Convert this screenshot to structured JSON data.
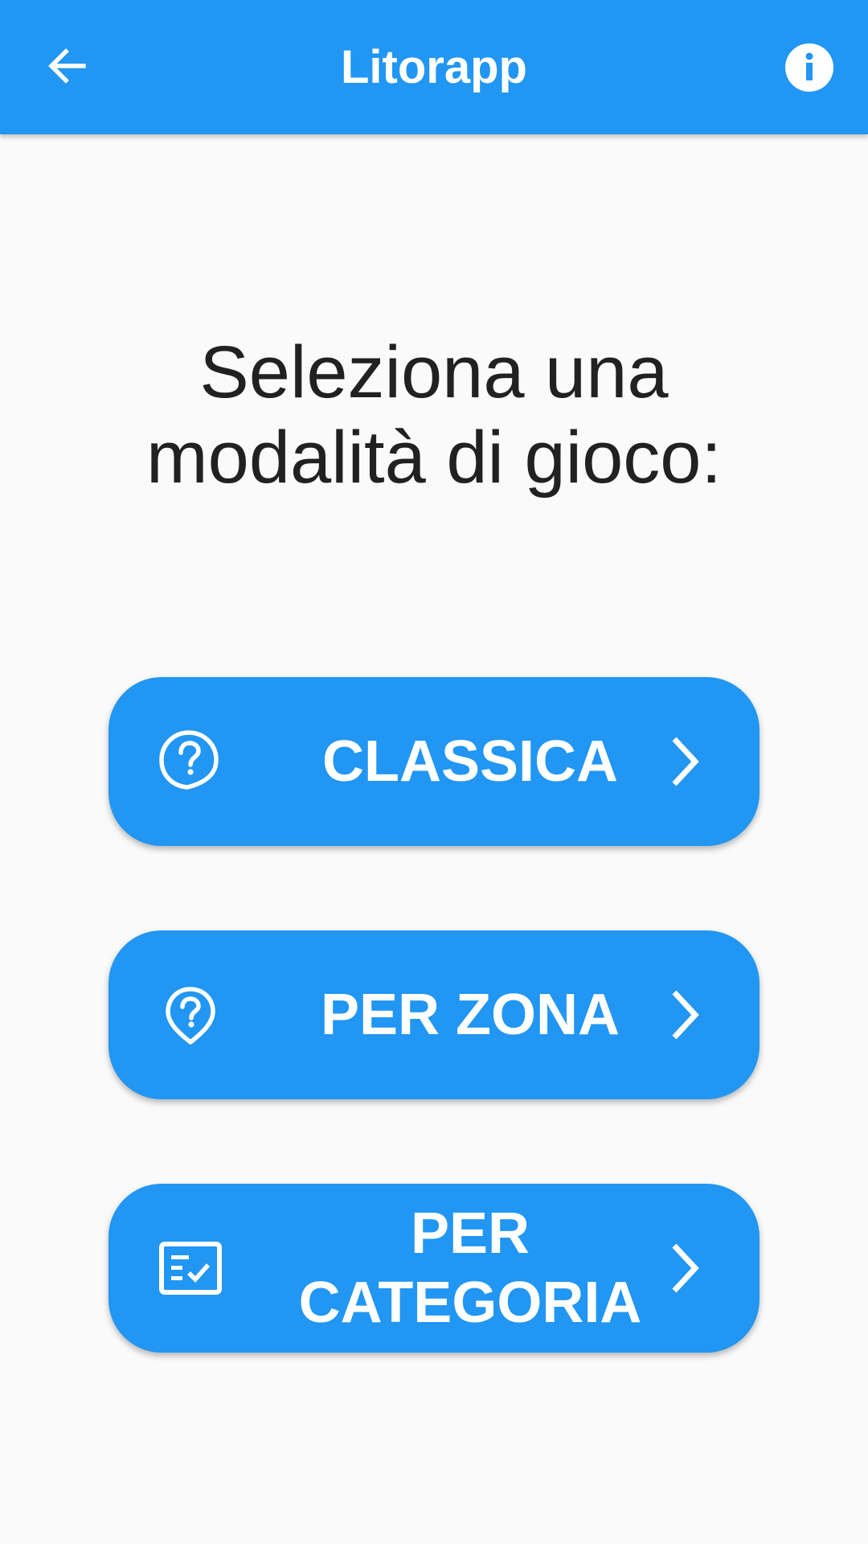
{
  "appbar": {
    "title": "Litorapp",
    "back_icon": "arrow-back-icon",
    "info_icon": "info-icon",
    "color": "#2196f3"
  },
  "heading": {
    "line1": "Seleziona una",
    "line2": "modalità di gioco:"
  },
  "modes": [
    {
      "label": "CLASSICA",
      "icon": "question-bubble-icon"
    },
    {
      "label": "PER ZONA",
      "icon": "question-pin-icon"
    },
    {
      "label_line1": "PER",
      "label_line2": "CATEGORIA",
      "icon": "checklist-icon"
    }
  ],
  "colors": {
    "accent": "#2196f3",
    "background": "#fafafa",
    "text": "#212121"
  }
}
